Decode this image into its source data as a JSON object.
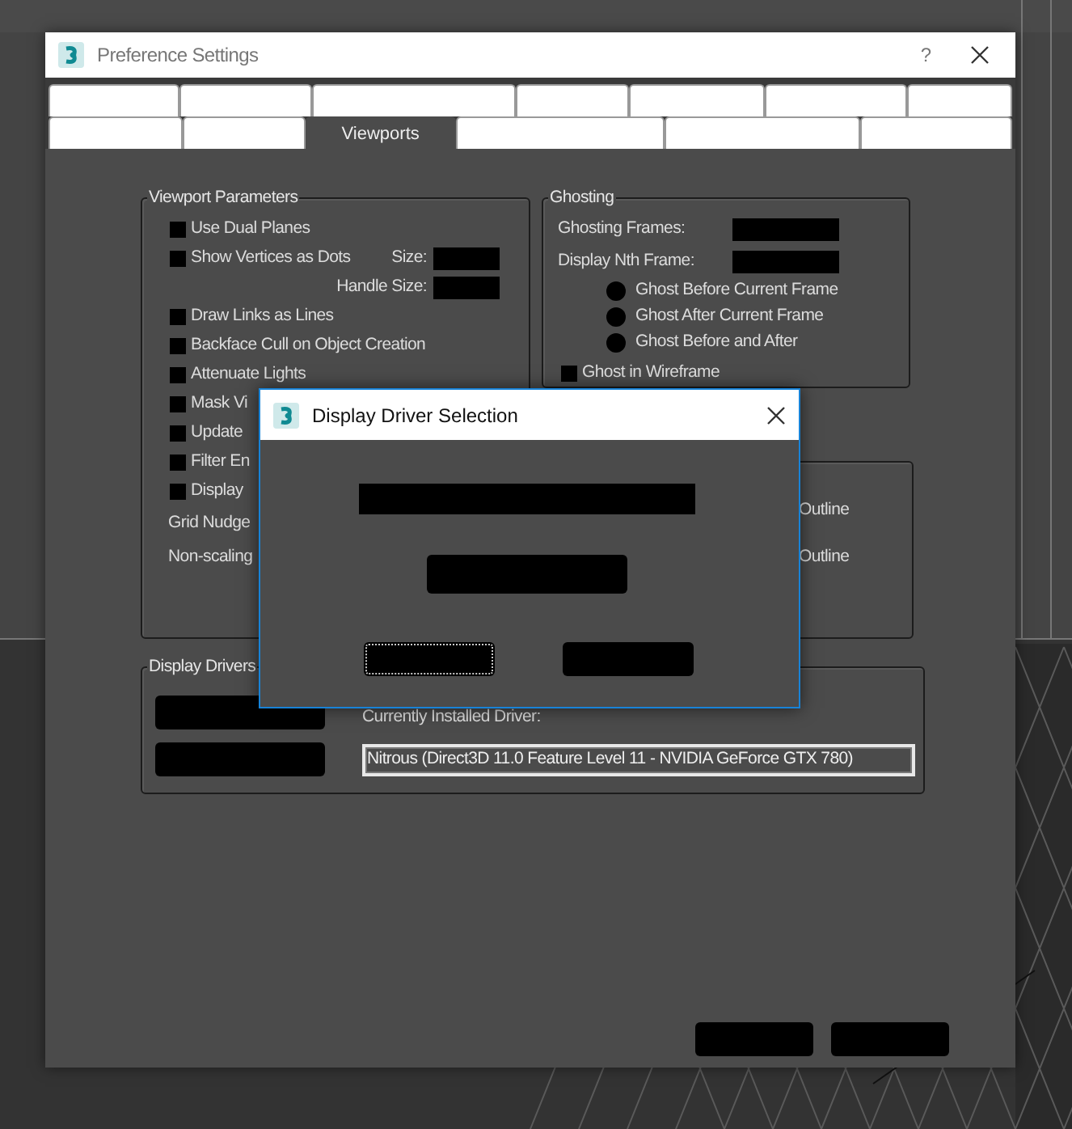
{
  "window": {
    "title": "Preference Settings",
    "help": "?"
  },
  "tabs": [
    [
      {
        "selected": false
      },
      {
        "selected": false
      },
      {
        "selected": false
      },
      {
        "selected": false
      },
      {
        "selected": false
      },
      {
        "selected": false
      },
      {
        "selected": false
      }
    ],
    [
      {
        "selected": false
      },
      {
        "selected": false
      },
      {
        "label": "Viewports",
        "selected": true
      },
      {
        "selected": false
      },
      {
        "selected": false
      },
      {
        "selected": false
      }
    ]
  ],
  "viewport_parameters": {
    "title": "Viewport Parameters",
    "items": [
      {
        "kind": "checkbox",
        "label": "Use Dual Planes",
        "checked": false
      },
      {
        "kind": "checkbox",
        "label": "Show Vertices as Dots",
        "checked": false,
        "field_label": "Size:"
      },
      {
        "kind": "field",
        "field_label": "Handle Size:"
      },
      {
        "kind": "checkbox",
        "label": "Draw Links as Lines",
        "checked": false
      },
      {
        "kind": "checkbox",
        "label": "Backface Cull on Object Creation",
        "checked": false
      },
      {
        "kind": "checkbox",
        "label": "Attenuate Lights",
        "checked": false
      },
      {
        "kind": "checkbox",
        "label": "Mask Vi",
        "checked": false
      },
      {
        "kind": "checkbox",
        "label": "Update",
        "checked": false
      },
      {
        "kind": "checkbox",
        "label": "Filter En",
        "checked": false
      },
      {
        "kind": "checkbox",
        "label": "Display",
        "checked": false
      },
      {
        "kind": "text",
        "label": "Grid Nudge"
      },
      {
        "kind": "text",
        "label": "Non-scaling"
      }
    ]
  },
  "ghosting": {
    "title": "Ghosting",
    "fields": [
      {
        "label": "Ghosting Frames:"
      },
      {
        "label": "Display Nth Frame:"
      }
    ],
    "radios": [
      {
        "label": "Ghost Before Current Frame",
        "selected": false
      },
      {
        "label": "Ghost After Current Frame",
        "selected": false
      },
      {
        "label": "Ghost Before and After",
        "selected": false
      }
    ],
    "wireframe": {
      "label": "Ghost in Wireframe",
      "checked": false
    }
  },
  "outline_group": {
    "items": [
      {
        "label": "Outline"
      },
      {
        "label": "Outline"
      }
    ]
  },
  "display_drivers": {
    "title": "Display Drivers",
    "current_label": "Currently Installed Driver:",
    "current_value": "Nitrous (Direct3D 11.0 Feature Level 11 - NVIDIA GeForce GTX 780)"
  },
  "dialog": {
    "title": "Display Driver Selection"
  }
}
